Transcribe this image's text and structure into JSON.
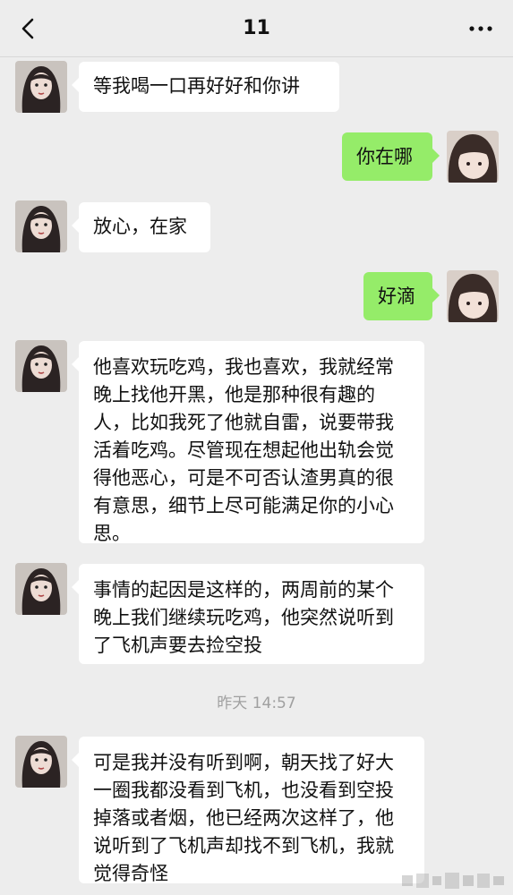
{
  "header": {
    "title": "11",
    "back_icon": "chevron-left-icon",
    "more_icon": "more-dots-icon"
  },
  "colors": {
    "background": "#ededed",
    "left_bubble": "#ffffff",
    "right_bubble": "#95ec69",
    "timestamp_text": "#a0a0a0"
  },
  "messages": [
    {
      "side": "left",
      "text": "等我喝一口再好好和你讲"
    },
    {
      "side": "right",
      "text": "你在哪"
    },
    {
      "side": "left",
      "text": "放心，在家"
    },
    {
      "side": "right",
      "text": "好滴"
    },
    {
      "side": "left",
      "text": "他喜欢玩吃鸡，我也喜欢，我就经常晚上找他开黑，他是那种很有趣的人，比如我死了他就自雷，说要带我活着吃鸡。尽管现在想起他出轨会觉得他恶心，可是不可否认渣男真的很有意思，细节上尽可能满足你的小心思。"
    },
    {
      "side": "left",
      "text": "事情的起因是这样的，两周前的某个晚上我们继续玩吃鸡，他突然说听到了飞机声要去捡空投"
    },
    {
      "side": "left",
      "text": "可是我并没有听到啊，朝天找了好大一圈我都没看到飞机，也没看到空投掉落或者烟，他已经两次这样了，他说听到了飞机声却找不到飞机，我就觉得奇怪"
    }
  ],
  "timestamp": "昨天 14:57"
}
